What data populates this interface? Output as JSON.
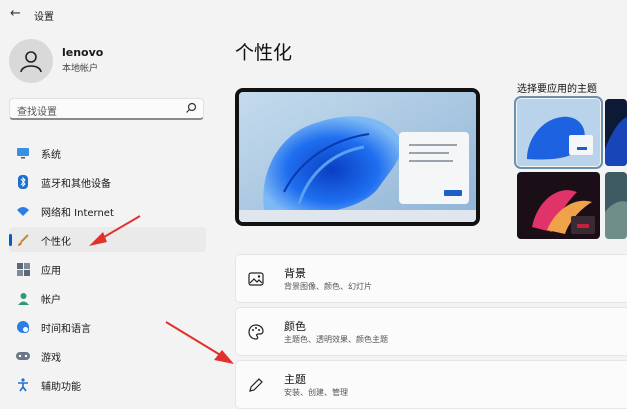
{
  "titlebar": {
    "title": "设置"
  },
  "user": {
    "name": "lenovo",
    "account": "本地帐户"
  },
  "search": {
    "placeholder": "查找设置"
  },
  "nav": [
    {
      "label": "系统",
      "icon": "monitor-icon"
    },
    {
      "label": "蓝牙和其他设备",
      "icon": "bluetooth-icon"
    },
    {
      "label": "网络和 Internet",
      "icon": "wifi-icon"
    },
    {
      "label": "个性化",
      "icon": "brush-icon",
      "selected": true
    },
    {
      "label": "应用",
      "icon": "apps-icon"
    },
    {
      "label": "帐户",
      "icon": "person-icon"
    },
    {
      "label": "时间和语言",
      "icon": "globe-clock-icon"
    },
    {
      "label": "游戏",
      "icon": "gamepad-icon"
    },
    {
      "label": "辅助功能",
      "icon": "accessibility-icon"
    }
  ],
  "main": {
    "title": "个性化",
    "themes_title": "选择要应用的主题",
    "cards": [
      {
        "title": "背景",
        "subtitle": "背景图像、颜色、幻灯片",
        "icon": "image-icon"
      },
      {
        "title": "颜色",
        "subtitle": "主题色、透明效果、颜色主题",
        "icon": "palette-icon"
      },
      {
        "title": "主题",
        "subtitle": "安装、创建、管理",
        "icon": "pen-icon"
      }
    ]
  },
  "colors": {
    "accent": "#005fb8",
    "arrow": "#e0312c"
  }
}
